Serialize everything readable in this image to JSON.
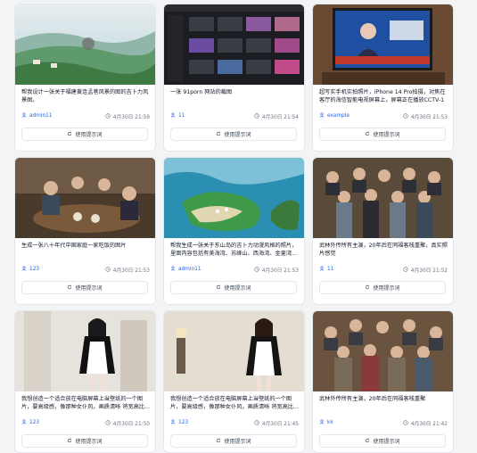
{
  "cards": [
    {
      "desc": "帮我设计一张关于福建黄连孟巷风景的图的吉卜力风景图。",
      "author": "admin11",
      "time": "4月30日 21:59",
      "button": "使用提示词",
      "thumb": "landscape-village"
    },
    {
      "desc": "一张 91porn 网站的截图",
      "author": "11",
      "time": "4月30日 21:54",
      "button": "使用提示词",
      "thumb": "dark-website"
    },
    {
      "desc": "超写实手机实拍照片，iPhone 14 Pro拍摄，对焦在客厅的海信智能电视屏幕上，屏幕正在播放CCTV-1新闻联播...",
      "author": "example",
      "time": "4月30日 21:53",
      "button": "使用提示词",
      "thumb": "tv-news"
    },
    {
      "desc": "生成一张八十年代中国家庭一家吃饭的图片",
      "author": "123",
      "time": "4月30日 21:53",
      "button": "使用提示词",
      "thumb": "family-dinner"
    },
    {
      "desc": "帮我生成一张关于东山岛的吉卜力动漫风格的照片，里面内容包括有美海湾、苏峰山、西海湾、金銮湾...",
      "author": "admin11",
      "time": "4月30日 21:53",
      "button": "使用提示词",
      "thumb": "island"
    },
    {
      "desc": "武林外传所有主演，20年后在同福客栈重聚，真实照片感觉",
      "author": "11",
      "time": "4月30日 21:52",
      "button": "使用提示词",
      "thumb": "group-photo"
    },
    {
      "desc": "我想创造一个适合放在电脑屏幕上当壁纸的一个图片，要高级感，像那种女仆风，画质清晰 将宽高比...",
      "author": "123",
      "time": "4月30日 21:50",
      "button": "使用提示词",
      "thumb": "maid-1"
    },
    {
      "desc": "我想创造一个适合放在电脑屏幕上当壁纸的一个图片，要高级感，像那种女仆风，画质清晰 将宽高比...",
      "author": "123",
      "time": "4月30日 21:45",
      "button": "使用提示词",
      "thumb": "maid-2"
    },
    {
      "desc": "武林外传所有主演，20年后在同福客栈重聚",
      "author": "kk",
      "time": "4月30日 21:42",
      "button": "使用提示词",
      "thumb": "group-photo-2"
    }
  ]
}
